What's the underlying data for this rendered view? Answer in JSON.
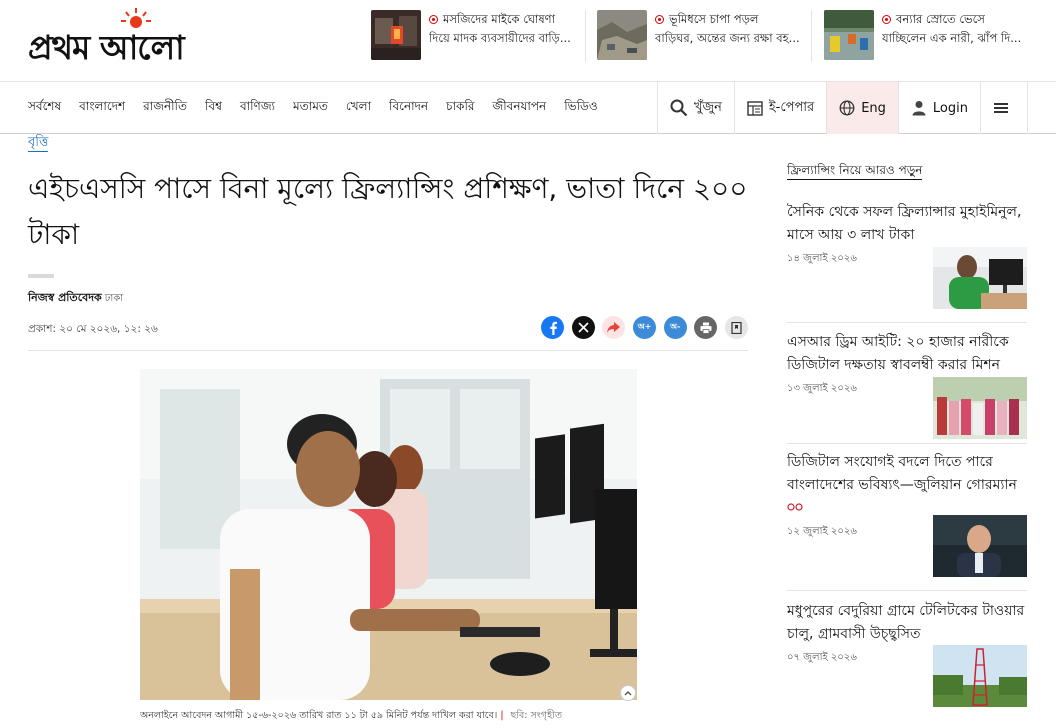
{
  "header": {
    "logo_text": "প্রথম আলো",
    "trending": [
      {
        "title": "মসজিদের মাইকে ঘোষণা",
        "subtitle": "দিয়ে মাদক ব্যবসায়ীদের বাড়ি..."
      },
      {
        "title": "ভূমিধসে চাপা পড়ল",
        "subtitle": "বাড়িঘর, অন্তের জন্য রক্ষা বহ..."
      },
      {
        "title": "বন্যার স্রোতে ভেসে",
        "subtitle": "যাচ্ছিলেন এক নারী, ঝাঁপ দি..."
      }
    ]
  },
  "nav": {
    "items": [
      "সর্বশেষ",
      "বাংলাদেশ",
      "রাজনীতি",
      "বিশ্ব",
      "বাণিজ্য",
      "মতামত",
      "খেলা",
      "বিনোদন",
      "চাকরি",
      "জীবনযাপন",
      "ভিডিও"
    ],
    "search_label": "খুঁজুন",
    "epaper_label": "ই-পেপার",
    "lang_label": "Eng",
    "login_label": "Login"
  },
  "article": {
    "category": "বৃত্তি",
    "headline": "এইচএসসি পাসে বিনা মূল্যে ফ্রিল্যান্সিং প্রশিক্ষণ, ভাতা দিনে ২০০ টাকা",
    "author": "নিজস্ব প্রতিবেদক",
    "location": "ঢাকা",
    "published": "প্রকাশ: ২০ মে ২০২৬, ১২: ২৬",
    "share_labels": {
      "font_up": "অ+",
      "font_down": "অ-"
    },
    "caption": "অনলাইনে আবেদন আগামী ১৫-৬-২০২৬ তারিখ রাত ১১ টা ৫৯ মিনিট পর্যন্ত দাখিল করা যাবে।",
    "caption_credit": "ছবি: সংগৃহীত"
  },
  "sidebar": {
    "heading": "ফ্রিল্যান্সিং নিয়ে আরও পড়ুন",
    "items": [
      {
        "title": "সৈনিক থেকে সফল ফ্রিল্যান্সার মুহাইমিনুল, মাসে আয় ৩ লাখ টাকা",
        "date": "১৪ জুলাই ২০২৬"
      },
      {
        "title": "এসআর ড্রিম আইটি: ২০ হাজার নারীকে ডিজিটাল দক্ষতায় স্বাবলম্বী করার মিশন",
        "date": "১৩ জুলাই ২০২৬"
      },
      {
        "title": "ডিজিটাল সংযোগই বদলে দিতে পারে বাংলাদেশের ভবিষ্যৎ—জুলিয়ান গোরম্যান",
        "date": "১২ জুলাই ২০২৬"
      },
      {
        "title": "মধুপুরের বেদুরিয়া গ্রামে টেলিটকের টাওয়ার চালু, গ্রামবাসী উচ্ছ্বসিত",
        "date": "০৭ জুলাই ২০২৬"
      }
    ]
  },
  "colors": {
    "accent_red": "#d00000",
    "link_blue": "#1d6fb8",
    "facebook": "#1877f2",
    "share_orange": "#f0523a"
  }
}
